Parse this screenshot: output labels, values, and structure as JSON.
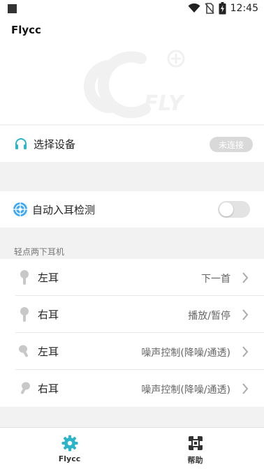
{
  "status_bar": {
    "time": "12:45"
  },
  "app": {
    "title": "Flycc",
    "logo_text": "FLY"
  },
  "device": {
    "label": "选择设备",
    "status": "未连接",
    "icon": "headphones-icon"
  },
  "auto_ear": {
    "label": "自动入耳检测",
    "enabled": false,
    "icon": "target-icon"
  },
  "double_tap": {
    "section_title": "轻点两下耳机",
    "items": [
      {
        "label": "左耳",
        "value": "下一首",
        "icon": "left-earbud-icon"
      },
      {
        "label": "右耳",
        "value": "播放/暂停",
        "icon": "right-earbud-icon"
      },
      {
        "label": "左耳",
        "value": "噪声控制(降噪/通透)",
        "icon": "left-earbud-icon"
      },
      {
        "label": "右耳",
        "value": "噪声控制(降噪/通透)",
        "icon": "right-earbud-icon"
      }
    ]
  },
  "tabs": [
    {
      "label": "Flycc",
      "icon": "gear-icon",
      "active": true
    },
    {
      "label": "帮助",
      "icon": "help-icon",
      "active": false
    }
  ],
  "colors": {
    "accent": "#2bb5c8",
    "background": "#f2f2f2",
    "pill": "#d9d9d9"
  }
}
